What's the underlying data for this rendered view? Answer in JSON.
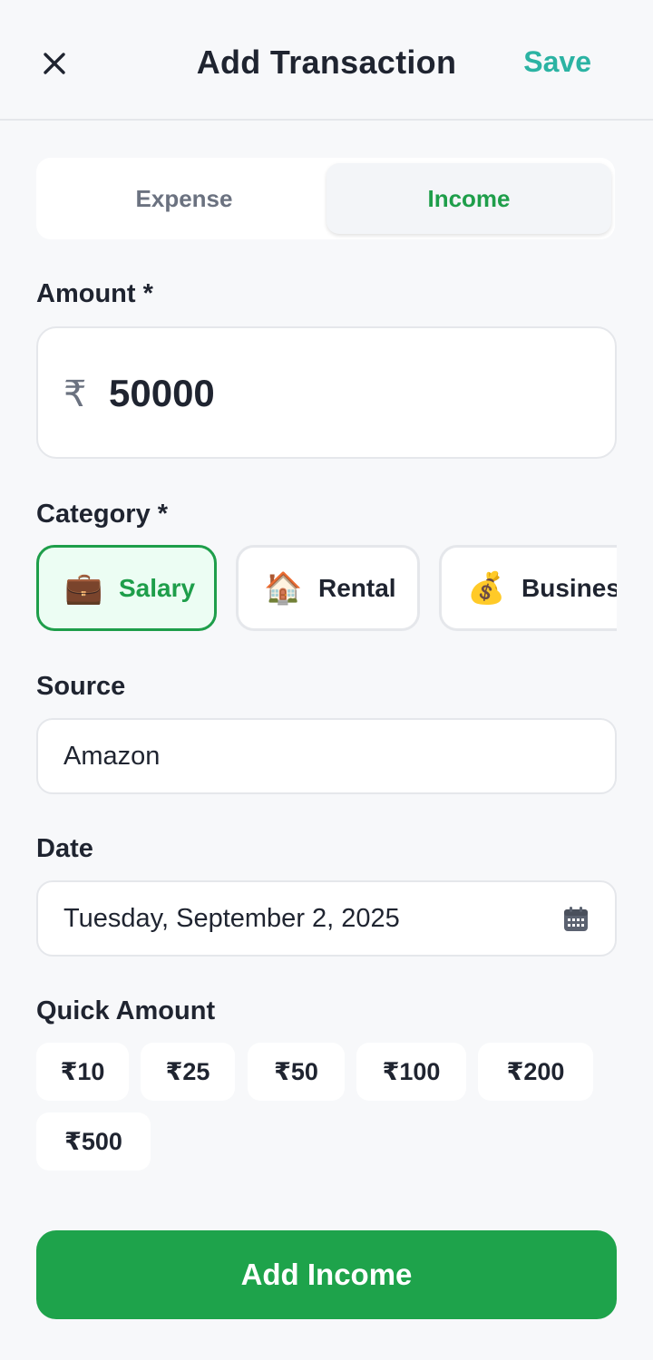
{
  "header": {
    "close_icon": "close-icon",
    "title": "Add Transaction",
    "save_label": "Save"
  },
  "type_toggle": {
    "options": [
      "Expense",
      "Income"
    ],
    "selected": "Income"
  },
  "amount": {
    "label": "Amount *",
    "currency_symbol": "₹",
    "value": "50000"
  },
  "category": {
    "label": "Category *",
    "items": [
      {
        "icon": "briefcase-icon",
        "emoji": "💼",
        "label": "Salary",
        "selected": true
      },
      {
        "icon": "house-icon",
        "emoji": "🏠",
        "label": "Rental",
        "selected": false
      },
      {
        "icon": "money-bag-icon",
        "emoji": "💰",
        "label": "Business",
        "selected": false
      }
    ]
  },
  "source": {
    "label": "Source",
    "value": "Amazon"
  },
  "date": {
    "label": "Date",
    "value": "Tuesday, September 2, 2025",
    "icon": "calendar-icon"
  },
  "quick_amount": {
    "label": "Quick Amount",
    "chips": [
      "₹10",
      "₹25",
      "₹50",
      "₹100",
      "₹200",
      "₹500"
    ]
  },
  "submit": {
    "label": "Add Income"
  },
  "colors": {
    "accent_green": "#1ea34b",
    "save_teal": "#2bb3a3",
    "background": "#f7f8fa"
  }
}
